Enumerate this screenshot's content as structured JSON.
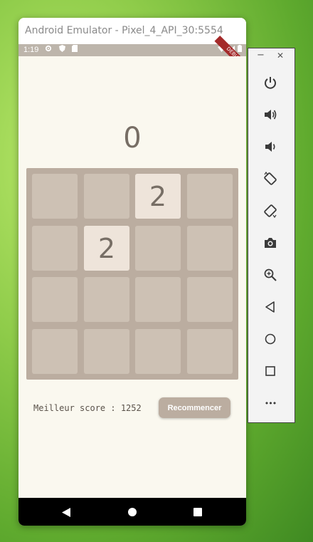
{
  "window": {
    "title": "Android Emulator - Pixel_4_API_30:5554"
  },
  "statusbar": {
    "time": "1:19",
    "debug_banner": "DEBUG"
  },
  "game": {
    "score": "0",
    "board": [
      [
        "",
        "",
        "2",
        ""
      ],
      [
        "",
        "2",
        "",
        ""
      ],
      [
        "",
        "",
        "",
        ""
      ],
      [
        "",
        "",
        "",
        ""
      ]
    ],
    "best_score": "Meilleur score : 1252",
    "restart_label": "Recommencer"
  },
  "colors": {
    "background": "#faf8ef",
    "board": "#bbada0",
    "empty_tile": "#cdc1b4",
    "tile_2": "#eee4da",
    "tile_text": "#776e65"
  },
  "emulator_panel": {
    "minimize": "−",
    "close": "✕",
    "controls": [
      "power-icon",
      "volume-up-icon",
      "volume-down-icon",
      "rotate-left-icon",
      "rotate-right-icon",
      "camera-icon",
      "zoom-icon",
      "back-icon",
      "home-icon",
      "overview-icon",
      "more-icon"
    ],
    "more": "•••"
  }
}
